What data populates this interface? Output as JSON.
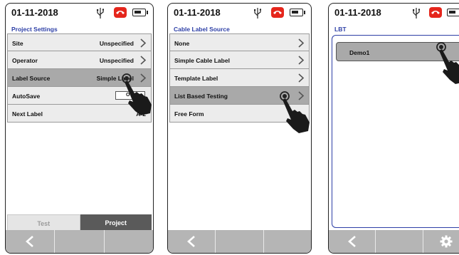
{
  "screens": [
    {
      "date": "01-11-2018",
      "section_title": "Project Settings",
      "rows": [
        {
          "label": "Site",
          "value": "Unspecified"
        },
        {
          "label": "Operator",
          "value": "Unspecified"
        },
        {
          "label": "Label Source",
          "value": "Simple Label"
        },
        {
          "label": "AutoSave",
          "value": "O"
        },
        {
          "label": "Next Label",
          "value": "A-2"
        }
      ],
      "tabs": [
        "Test",
        "Project"
      ]
    },
    {
      "date": "01-11-2018",
      "section_title": "Cable Label Source",
      "rows": [
        {
          "label": "None"
        },
        {
          "label": "Simple Cable Label"
        },
        {
          "label": "Template Label"
        },
        {
          "label": "List Based Testing"
        },
        {
          "label": "Free Form"
        }
      ]
    },
    {
      "date": "01-11-2018",
      "section_title": "LBT",
      "items": [
        {
          "label": "Demo1"
        }
      ]
    }
  ],
  "colors": {
    "section_title": "#2d3fa6",
    "selected_row": "#a9a9a9",
    "row_bg": "#ececec",
    "status_red": "#e5261c",
    "active_tab": "#5a5a5a"
  },
  "icons": [
    "usb-icon",
    "phone-icon",
    "battery-icon",
    "chevron-right-icon",
    "back-arrow-icon",
    "settings-gear-icon",
    "pointing-hand-icon"
  ]
}
